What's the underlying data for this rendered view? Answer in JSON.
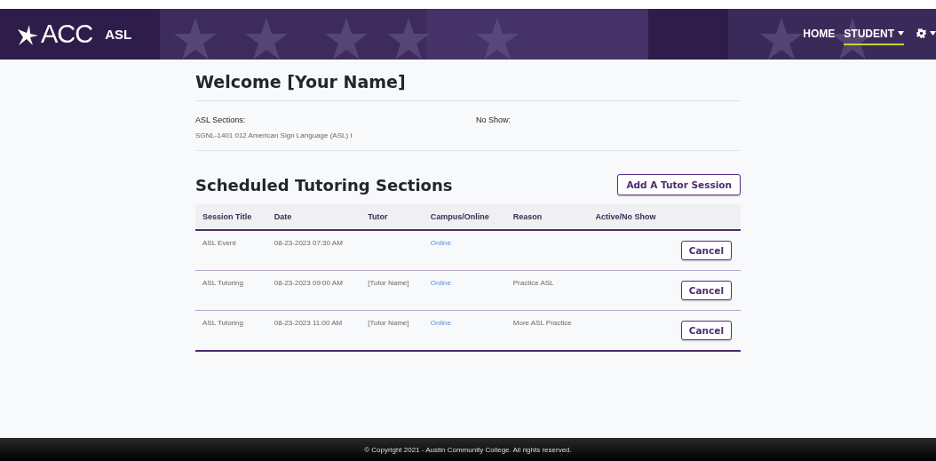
{
  "header": {
    "logo": "ACC",
    "app_name": "ASL",
    "nav": [
      {
        "label": "HOME",
        "selected": false,
        "dropdown": false
      },
      {
        "label": "STUDENT",
        "selected": true,
        "dropdown": true
      }
    ],
    "settings_menu": {
      "dropdown": true
    }
  },
  "welcome": {
    "title": "Welcome [Your Name]"
  },
  "info": [
    {
      "label": "ASL Sections:",
      "value": "SGNL-1401 012 American Sign Language (ASL) I"
    },
    {
      "label": "No Show:"
    }
  ],
  "sessions": {
    "title": "Scheduled Tutoring Sections",
    "add_button": "Add A Tutor Session",
    "columns": [
      "Session Title",
      "Date",
      "Tutor",
      "Campus/Online",
      "Reason",
      "Active/No Show"
    ],
    "rows": [
      {
        "session_title": "ASL Event",
        "date": "08-23-2023 07:30 AM",
        "mode": "Online",
        "action": "Cancel"
      },
      {
        "session_title": "ASL Tutoring",
        "date": "08-23-2023 09:00 AM",
        "tutor": "[Tutor Name]",
        "mode": "Online",
        "reason": "Practice ASL",
        "action": "Cancel"
      },
      {
        "session_title": "ASL Tutoring",
        "date": "08-23-2023 11:00 AM",
        "tutor": "[Tutor Name]",
        "mode": "Online",
        "reason": "More ASL Practice",
        "action": "Cancel"
      }
    ]
  },
  "footer": {
    "text": "© Copyright 2021 - Austin Community College. All rights reserved."
  }
}
